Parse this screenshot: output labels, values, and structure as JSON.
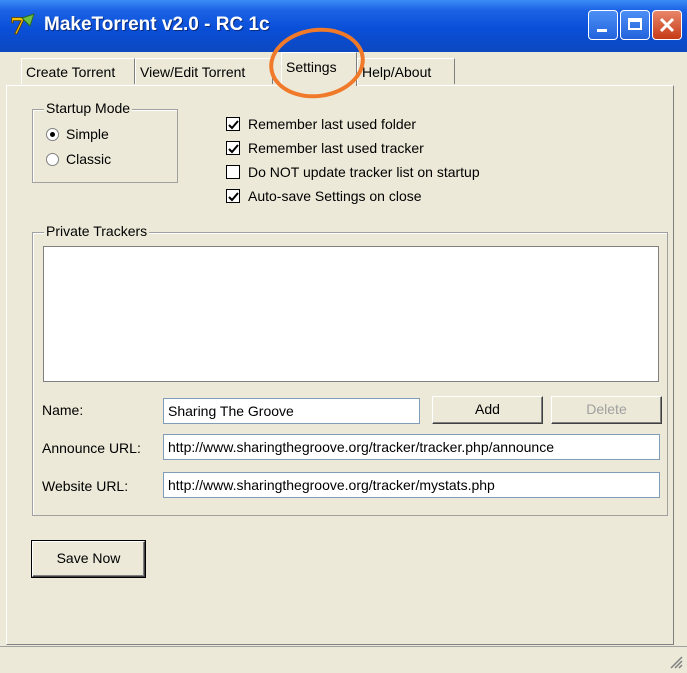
{
  "window": {
    "title": "MakeTorrent v2.0 - RC 1c"
  },
  "tabs": [
    {
      "label": "Create Torrent"
    },
    {
      "label": "View/Edit Torrent"
    },
    {
      "label": "Settings"
    },
    {
      "label": "Help/About"
    }
  ],
  "startup_mode": {
    "label": "Startup Mode",
    "options": [
      {
        "label": "Simple",
        "selected": true
      },
      {
        "label": "Classic",
        "selected": false
      }
    ]
  },
  "options": [
    {
      "label": "Remember last used folder",
      "checked": true
    },
    {
      "label": "Remember last used tracker",
      "checked": true
    },
    {
      "label": "Do NOT update tracker list on startup",
      "checked": false
    },
    {
      "label": "Auto-save Settings on close",
      "checked": true
    }
  ],
  "private_trackers": {
    "label": "Private Trackers",
    "name_label": "Name:",
    "name_value": "Sharing The Groove",
    "announce_label": "Announce URL:",
    "announce_value": "http://www.sharingthegroove.org/tracker/tracker.php/announce",
    "website_label": "Website URL:",
    "website_value": "http://www.sharingthegroove.org/tracker/mystats.php",
    "add_label": "Add",
    "delete_label": "Delete"
  },
  "save_now_label": "Save Now",
  "colors": {
    "highlight_ring": "#f07a2a",
    "titlebar": "#0a4fd8"
  }
}
